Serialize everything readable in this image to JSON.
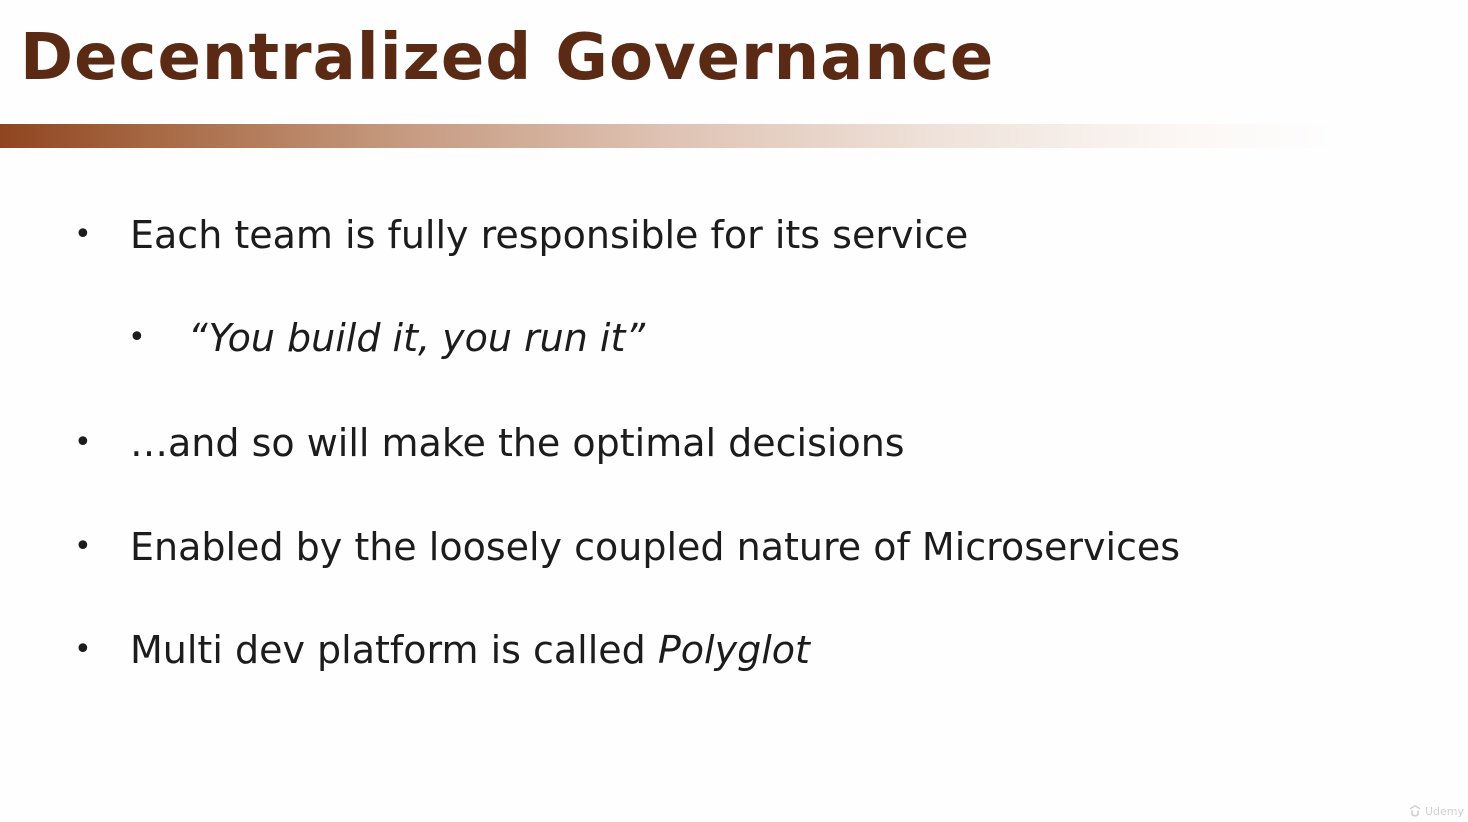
{
  "slide": {
    "title": "Decentralized Governance",
    "accent_color": "#8f4520",
    "title_color": "#5a2a14",
    "bullets": [
      {
        "level": 1,
        "text": "Each team is fully responsible for its service"
      },
      {
        "level": 2,
        "text": "“You build it, you run it”"
      },
      {
        "level": 1,
        "text": "…and so will make the optimal decisions"
      },
      {
        "level": 1,
        "text": "Enabled by the loosely coupled nature of Microservices"
      },
      {
        "level": 1,
        "text_prefix": "Multi dev platform is called ",
        "text_emphasis": "Polyglot"
      }
    ],
    "bullet_glyph": "•"
  },
  "watermark": {
    "icon": "udemy-logo-icon",
    "label": "Udemy"
  }
}
